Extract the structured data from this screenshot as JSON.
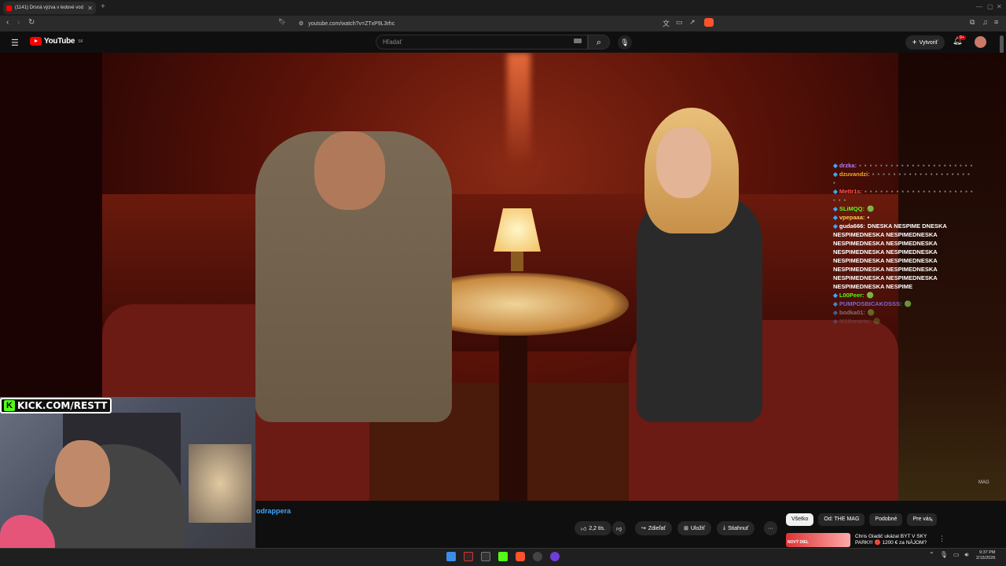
{
  "browser": {
    "tab_title": "(1141) Drsná výzva v ledové vod",
    "tab_close": "✕",
    "new_tab": "+",
    "url": "youtube.com/watch?v=ZTxP9L3rhc"
  },
  "youtube": {
    "logo_text": "YouTube",
    "logo_region": "SK",
    "search_placeholder": "Hľadať",
    "create_label": "Vytvoriť",
    "notif_count": "9+"
  },
  "video": {
    "watermark": "MAG",
    "channel_link": "odrappera"
  },
  "actions": {
    "like_label": "2,2 tis.",
    "share_label": "Zdieľať",
    "save_label": "Uložiť",
    "download_label": "Stiahnuť",
    "more_label": "···"
  },
  "chips": [
    "Všetko",
    "Od: THE MAG",
    "Podobné",
    "Pre vás"
  ],
  "recommendation": {
    "title": "Chris Gladič ukázal BYT V SKY PARK!!! 🔴 1200 € za NÁJOM?",
    "badge": "NOVÝ DIEL"
  },
  "chat": [
    {
      "name": "drzka:",
      "color": "#b47cff",
      "text": "",
      "dots": "▪ ▪ ▪ ▪ ▪ ▪ ▪ ▪ ▪ ▪ ▪ ▪ ▪ ▪ ▪ ▪ ▪ ▪ ▪ ▪ ▪ ▪"
    },
    {
      "name": "dzuvandzi:",
      "color": "#f5a623",
      "text": "",
      "dots": "▪ ▪ ▪ ▪ ▪ ▪ ▪ ▪ ▪ ▪ ▪ ▪ ▪ ▪ ▪ ▪ ▪ ▪ ▪ ▪"
    },
    {
      "name": "Mettr1s:",
      "color": "#ff4d4d",
      "text": "",
      "dots": "▪ ▪ ▪ ▪ ▪ ▪ ▪ ▪ ▪ ▪ ▪ ▪ ▪ ▪ ▪ ▪ ▪ ▪ ▪ ▪ ▪ ▪ ▪ ▪"
    },
    {
      "name": "SLiMQQ:",
      "color": "#53fc18",
      "text": "🟢",
      "dots": ""
    },
    {
      "name": "vpepaaa:",
      "color": "#ffc857",
      "text": "▪",
      "dots": ""
    },
    {
      "name": "guda666:",
      "color": "#ffffff",
      "text": "DNESKA NESPIME DNESKA NESPIMEDNESKA NESPIMEDNESKA NESPIMEDNESKA NESPIMEDNESKA NESPIMEDNESKA NESPIMEDNESKA NESPIMEDNESKA NESPIMEDNESKA NESPIMEDNESKA NESPIMEDNESKA NESPIMEDNESKA NESPIMEDNESKA NESPIMEDNESKA NESPIME",
      "dots": ""
    },
    {
      "name": "L00Peer:",
      "color": "#53fc18",
      "text": "🟢",
      "dots": ""
    },
    {
      "name": "PUMPOSBICAKOSSS:",
      "color": "#8a7cff",
      "text": "🟢",
      "dots": ""
    },
    {
      "name": "bodka01:",
      "color": "#bbbbbb",
      "text": "🟢",
      "dots": ""
    },
    {
      "name": "M1lfonarts:",
      "color": "#888888",
      "text": "🟢",
      "dots": ""
    }
  ],
  "overlay": {
    "kick_text": "KICK.COM/RESTT",
    "kick_k": "K"
  },
  "taskbar": {
    "time": "9:37 PM",
    "date": "2/15/2026"
  },
  "colors": {
    "kick_green": "#53fc18",
    "yt_red": "#ff0000",
    "link_blue": "#3ea6ff"
  }
}
